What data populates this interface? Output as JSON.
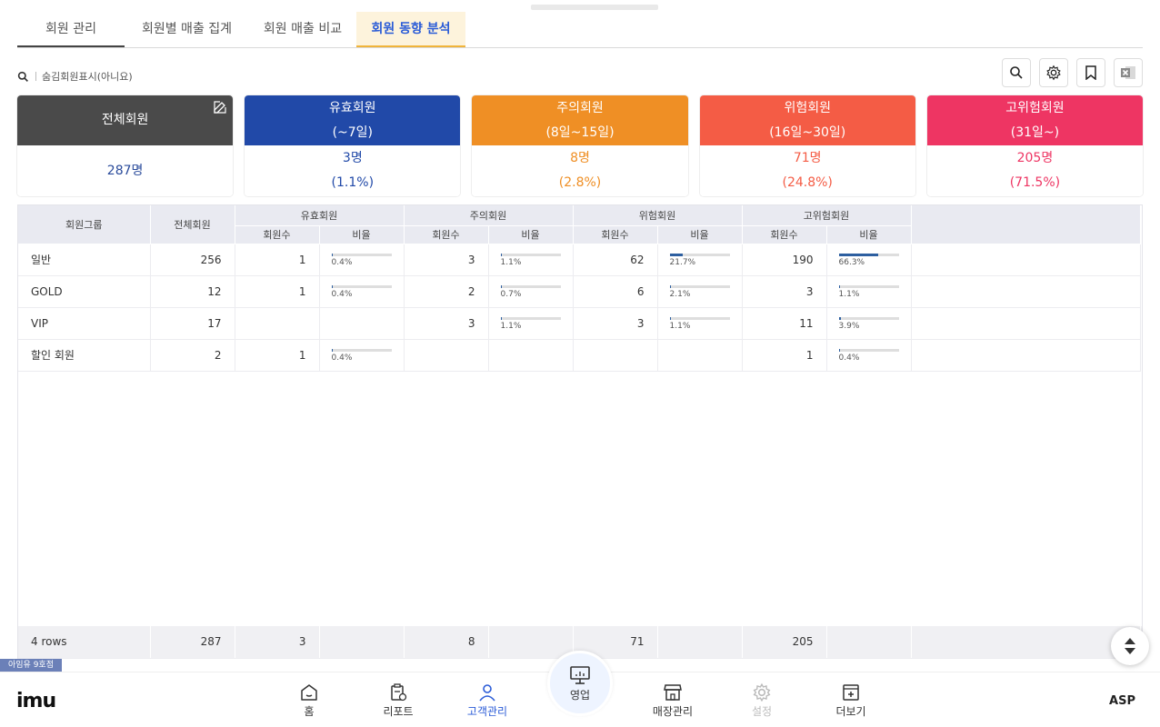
{
  "tabs": [
    {
      "label": "회원 관리"
    },
    {
      "label": "회원별 매출 집계"
    },
    {
      "label": "회원 매출 비교"
    },
    {
      "label": "회원 동향 분석"
    }
  ],
  "filter": {
    "label": "숨김회원표시(아니요)"
  },
  "toolbar_icons": [
    "search-icon",
    "gear-icon",
    "bookmark-icon",
    "excel-icon"
  ],
  "cards": [
    {
      "title": "전체회원",
      "subtitle": "",
      "count": "287명",
      "percent": "",
      "color": "#4a4a4a"
    },
    {
      "title": "유효회원",
      "subtitle": "(~7일)",
      "count": "3명",
      "percent": "(1.1%)",
      "color": "#2149a8"
    },
    {
      "title": "주의회원",
      "subtitle": "(8일~15일)",
      "count": "8명",
      "percent": "(2.8%)",
      "color": "#ef8f25"
    },
    {
      "title": "위험회원",
      "subtitle": "(16일~30일)",
      "count": "71명",
      "percent": "(24.8%)",
      "color": "#f45c45"
    },
    {
      "title": "고위험회원",
      "subtitle": "(31일~)",
      "count": "205명",
      "percent": "(71.5%)",
      "color": "#ee3563"
    }
  ],
  "table": {
    "col_group": "회원그룹",
    "col_total": "전체회원",
    "groups": [
      "유효회원",
      "주의회원",
      "위험회원",
      "고위험회원"
    ],
    "sub_count": "회원수",
    "sub_ratio": "비율",
    "rows": [
      {
        "name": "일반",
        "total": "256",
        "cells": [
          [
            "1",
            "0.4%",
            0.004
          ],
          [
            "3",
            "1.1%",
            0.011
          ],
          [
            "62",
            "21.7%",
            0.217
          ],
          [
            "190",
            "66.3%",
            0.663
          ]
        ]
      },
      {
        "name": "GOLD",
        "total": "12",
        "cells": [
          [
            "1",
            "0.4%",
            0.004
          ],
          [
            "2",
            "0.7%",
            0.007
          ],
          [
            "6",
            "2.1%",
            0.021
          ],
          [
            "3",
            "1.1%",
            0.011
          ]
        ]
      },
      {
        "name": "VIP",
        "total": "17",
        "cells": [
          [
            "",
            "",
            null
          ],
          [
            "3",
            "1.1%",
            0.011
          ],
          [
            "3",
            "1.1%",
            0.011
          ],
          [
            "11",
            "3.9%",
            0.039
          ]
        ]
      },
      {
        "name": "할인 회원",
        "total": "2",
        "cells": [
          [
            "1",
            "0.4%",
            0.004
          ],
          [
            "",
            "",
            null
          ],
          [
            "",
            "",
            null
          ],
          [
            "1",
            "0.4%",
            0.004
          ]
        ]
      }
    ],
    "footer": {
      "rows_label": "4 rows",
      "total": "287",
      "counts": [
        "3",
        "8",
        "71",
        "205"
      ]
    }
  },
  "store_badge": "아임유 9호점",
  "nav": {
    "logo": "imu",
    "items": [
      {
        "label": "홈",
        "icon": "home-icon"
      },
      {
        "label": "리포트",
        "icon": "report-icon"
      },
      {
        "label": "고객관리",
        "icon": "customer-icon"
      },
      {
        "label": "영업",
        "icon": "sales-icon"
      },
      {
        "label": "매장관리",
        "icon": "store-icon"
      },
      {
        "label": "설정",
        "icon": "settings-icon"
      },
      {
        "label": "더보기",
        "icon": "more-icon"
      }
    ],
    "right_label": "ASP"
  }
}
